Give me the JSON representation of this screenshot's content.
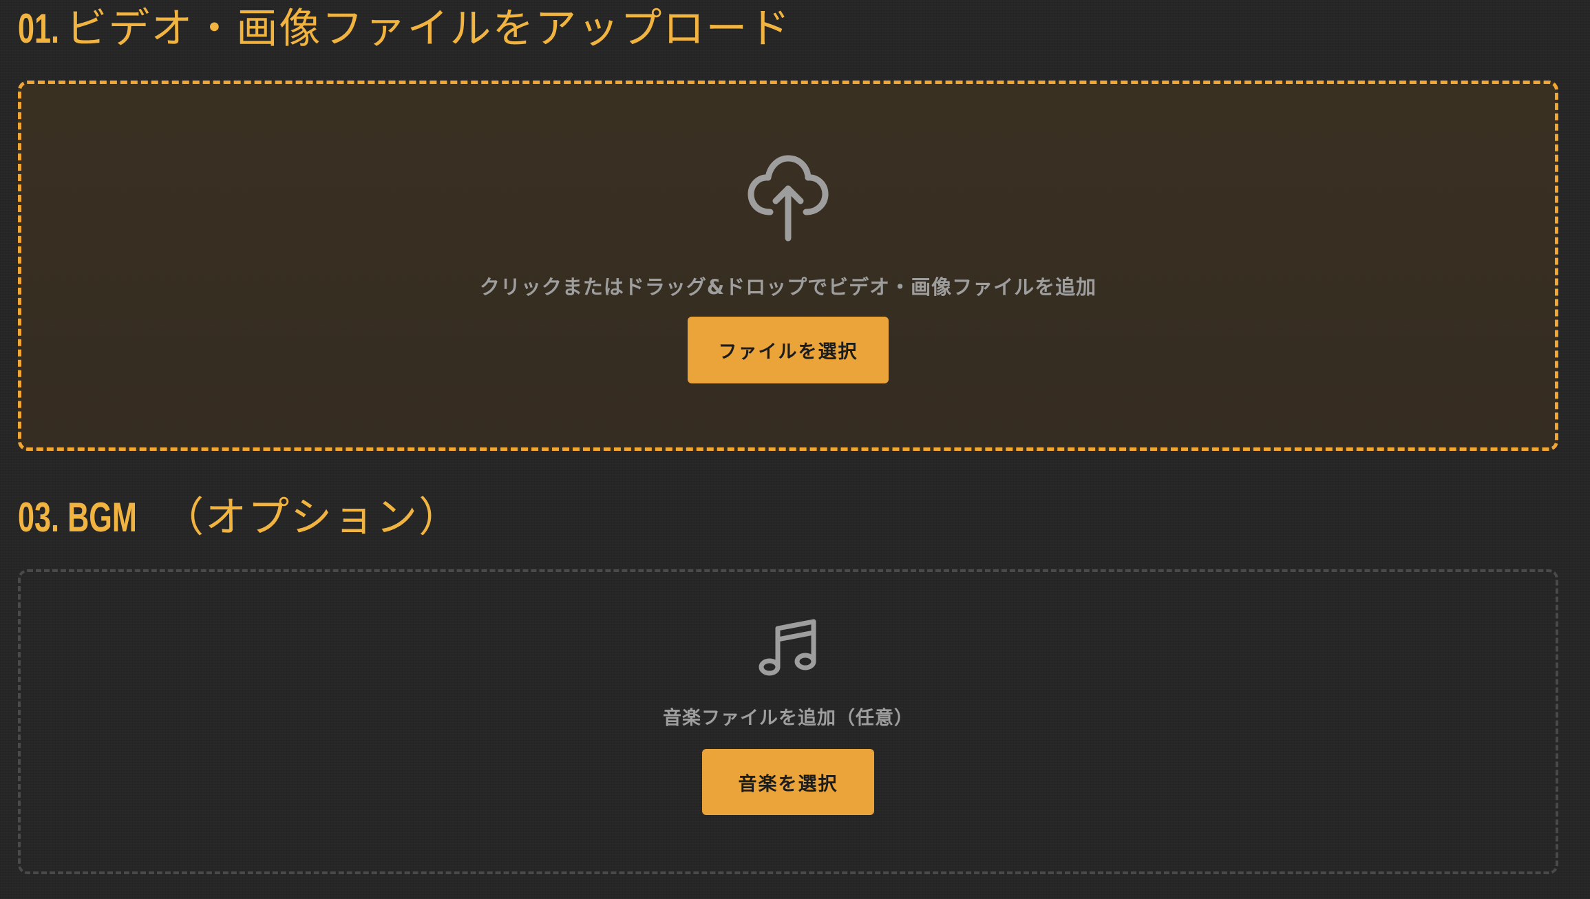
{
  "sections": {
    "upload": {
      "number": "01.",
      "title": "ビデオ・画像ファイルをアップロード",
      "icon": "cloud-upload-icon",
      "hint": "クリックまたはドラッグ&ドロップでビデオ・画像ファイルを追加",
      "button_label": "ファイルを選択"
    },
    "bgm": {
      "number": "03.",
      "title_prefix": "BGM",
      "title": "（オプション）",
      "icon": "music-note-icon",
      "hint": "音楽ファイルを追加（任意）",
      "button_label": "音楽を選択"
    }
  },
  "colors": {
    "background": "#262626",
    "accent": "#f2b441",
    "button": "#eba43a",
    "upload_border": "#f2a634",
    "bgm_border": "#4a4a4a",
    "muted_text": "#9e9e9e"
  }
}
